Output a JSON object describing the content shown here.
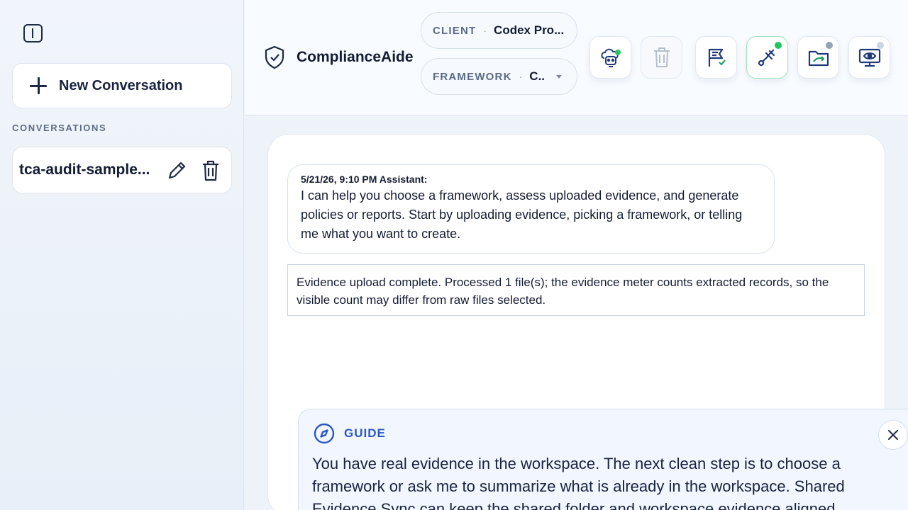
{
  "sidebar": {
    "new_conversation_label": "New Conversation",
    "section_label": "CONVERSATIONS",
    "conversations": [
      {
        "title": "tca-audit-sample..."
      }
    ]
  },
  "header": {
    "brand": "ComplianceAide",
    "client": {
      "key": "CLIENT",
      "separator": "·",
      "value": "Codex Pro..."
    },
    "framework": {
      "key": "FRAMEWORK",
      "separator": "·",
      "value": "C.."
    },
    "tools": [
      {
        "icon": "cloud-robot-icon",
        "status": "online",
        "status_color": "#22c55e"
      },
      {
        "icon": "trash-icon",
        "status": "disabled"
      },
      {
        "icon": "flag-check-icon"
      },
      {
        "icon": "satellite-link-icon",
        "status": "active",
        "status_color": "#22c55e"
      },
      {
        "icon": "folder-sync-icon",
        "status_color": "#94a3b8"
      },
      {
        "icon": "monitor-eye-icon",
        "status_color": "#cbd5e1"
      }
    ]
  },
  "chat": {
    "messages": [
      {
        "meta": "5/21/26, 9:10 PM Assistant:",
        "text": "I can help you choose a framework, assess uploaded evidence, and generate policies or reports. Start by uploading evidence, picking a framework, or telling me what you want to create."
      }
    ],
    "notice": "Evidence upload complete. Processed 1 file(s); the evidence meter counts extracted records, so the visible count may differ from raw files selected."
  },
  "guide": {
    "title": "GUIDE",
    "text": "You have real evidence in the workspace. The next clean step is to choose a framework or ask me to summarize what is already in the workspace. Shared Evidence Sync can keep the shared folder and workspace evidence aligned."
  },
  "colors": {
    "accent": "#2b56c7",
    "online": "#22c55e",
    "text": "#141c33"
  }
}
